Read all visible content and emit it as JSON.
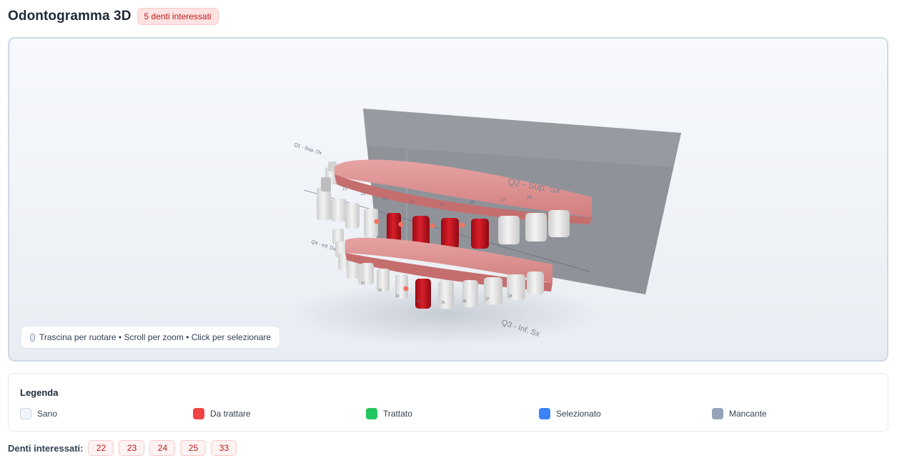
{
  "header": {
    "title": "Odontogramma 3D",
    "badge": "5 denti interessati"
  },
  "viewer": {
    "hint": "Trascina per ruotare • Scroll per zoom • Click per selezionare",
    "quadrant_labels": {
      "q1": "Q1 - Sup. Dx",
      "q2": "Q2 - Sup. Sx",
      "q3": "Q3 - Inf. Sx",
      "q4": "Q4 - Inf. Dx"
    },
    "upper_tooth_numbers": [
      "21",
      "22",
      "23",
      "24",
      "25",
      "26",
      "27",
      "28"
    ],
    "lower_tooth_numbers": [
      "31",
      "32",
      "33",
      "34",
      "35",
      "36",
      "37",
      "38"
    ]
  },
  "legend": {
    "title": "Legenda",
    "items": [
      {
        "label": "Sano",
        "color": "#f1f5f9"
      },
      {
        "label": "Da trattare",
        "color": "#ef4444"
      },
      {
        "label": "Trattato",
        "color": "#22c55e"
      },
      {
        "label": "Selezionato",
        "color": "#3b82f6"
      },
      {
        "label": "Mancante",
        "color": "#94a3b8"
      }
    ]
  },
  "affected": {
    "label": "Denti interessati:",
    "teeth": [
      "22",
      "23",
      "24",
      "25",
      "33"
    ]
  },
  "colors": {
    "gum": "#d88a8a",
    "healthy_tooth": "#e6e6e6",
    "to_treat": "#c8101c",
    "plane": "#8f9399"
  }
}
